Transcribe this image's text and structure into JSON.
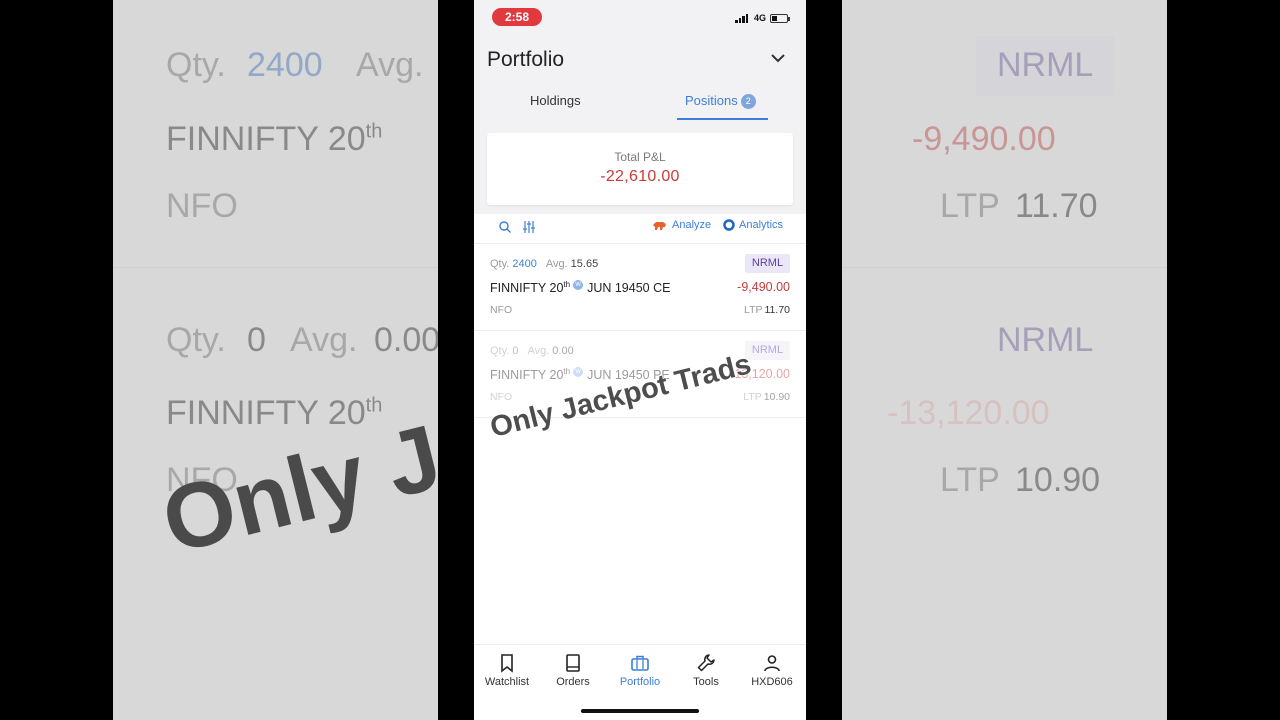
{
  "status_bar": {
    "time": "2:58",
    "network": "4G"
  },
  "header": {
    "title": "Portfolio"
  },
  "tabs": [
    {
      "label": "Holdings"
    },
    {
      "label": "Positions",
      "badge": "2"
    }
  ],
  "summary": {
    "label": "Total P&L",
    "value": "-22,610.00"
  },
  "toolbar": {
    "analyze_label": "Analyze",
    "analytics_label": "Analytics"
  },
  "positions": [
    {
      "qty_label": "Qty.",
      "qty": "2400",
      "avg_label": "Avg.",
      "avg": "15.65",
      "product": "NRML",
      "symbol": "FINNIFTY 20",
      "sup": "th",
      "weekly_badge": "W",
      "contract": "JUN 19450 CE",
      "pnl": "-9,490.00",
      "exchange": "NFO",
      "ltp_label": "LTP",
      "ltp": "11.70"
    },
    {
      "qty_label": "Qty.",
      "qty": "0",
      "avg_label": "Avg.",
      "avg": "0.00",
      "product": "NRML",
      "symbol": "FINNIFTY 20",
      "sup": "th",
      "weekly_badge": "W",
      "contract": "JUN 19450 PE",
      "pnl": "-13,120.00",
      "exchange": "NFO",
      "ltp_label": "LTP",
      "ltp": "10.90"
    }
  ],
  "watermark": "Only Jackpot Trads",
  "bottom_nav": [
    {
      "label": "Watchlist",
      "icon": "bookmark-icon"
    },
    {
      "label": "Orders",
      "icon": "book-icon"
    },
    {
      "label": "Portfolio",
      "icon": "briefcase-icon",
      "active": true
    },
    {
      "label": "Tools",
      "icon": "wrench-icon"
    },
    {
      "label": "HXD606",
      "icon": "user-icon"
    }
  ],
  "colors": {
    "accent": "#3d7fd6",
    "loss": "#cc3a3a",
    "product_bg": "#ece7f6",
    "status_time_bg": "#e0393e"
  }
}
